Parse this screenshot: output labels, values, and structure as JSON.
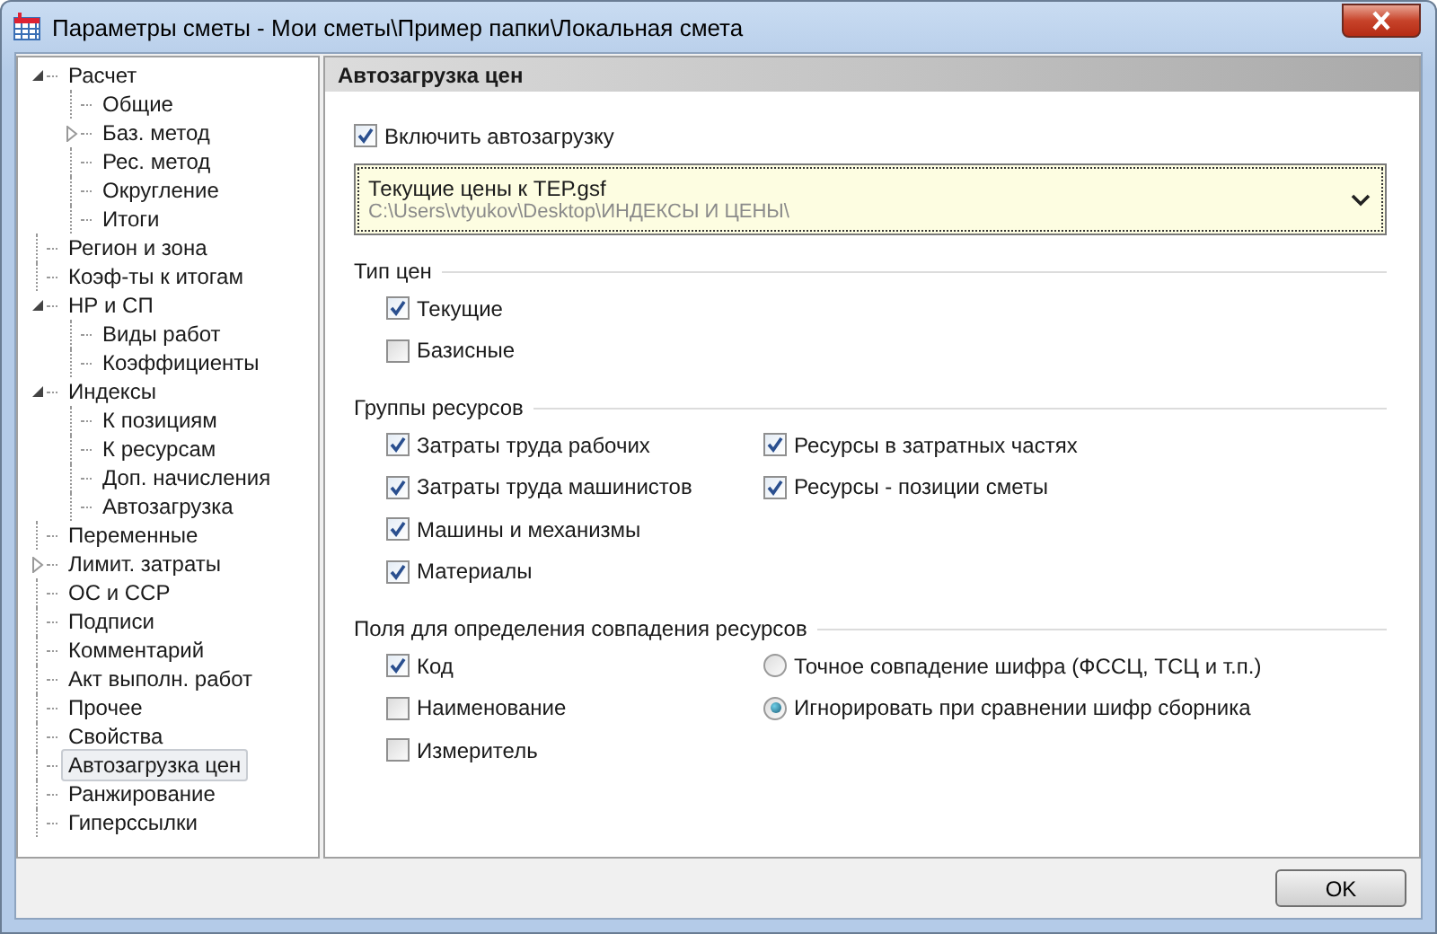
{
  "window": {
    "title": "Параметры сметы - Мои сметы\\Пример папки\\Локальная смета"
  },
  "sidebar": {
    "items": [
      {
        "label": "Расчет",
        "selected": false,
        "expanded": true,
        "children": [
          {
            "label": "Общие",
            "selected": false
          },
          {
            "label": "Баз. метод",
            "selected": false,
            "expanded": false
          },
          {
            "label": "Рес. метод",
            "selected": false
          },
          {
            "label": "Округление",
            "selected": false
          },
          {
            "label": "Итоги",
            "selected": false
          }
        ]
      },
      {
        "label": "Регион и зона",
        "selected": false
      },
      {
        "label": "Коэф-ты к итогам",
        "selected": false
      },
      {
        "label": "НР и СП",
        "selected": false,
        "expanded": true,
        "children": [
          {
            "label": "Виды работ",
            "selected": false
          },
          {
            "label": "Коэффициенты",
            "selected": false
          }
        ]
      },
      {
        "label": "Индексы",
        "selected": false,
        "expanded": true,
        "children": [
          {
            "label": "К позициям",
            "selected": false
          },
          {
            "label": "К ресурсам",
            "selected": false
          },
          {
            "label": "Доп. начисления",
            "selected": false
          },
          {
            "label": "Автозагрузка",
            "selected": false
          }
        ]
      },
      {
        "label": "Переменные",
        "selected": false
      },
      {
        "label": "Лимит. затраты",
        "selected": false,
        "expanded": false
      },
      {
        "label": "ОС и ССР",
        "selected": false
      },
      {
        "label": "Подписи",
        "selected": false
      },
      {
        "label": "Комментарий",
        "selected": false
      },
      {
        "label": "Акт выполн. работ",
        "selected": false
      },
      {
        "label": "Прочее",
        "selected": false
      },
      {
        "label": "Свойства",
        "selected": false
      },
      {
        "label": "Автозагрузка цен",
        "selected": true
      },
      {
        "label": "Ранжирование",
        "selected": false
      },
      {
        "label": "Гиперссылки",
        "selected": false
      }
    ]
  },
  "panel": {
    "title": "Автозагрузка цен",
    "autoload": {
      "label": "Включить автозагрузку",
      "checked": true
    },
    "price_file": {
      "name": "Текущие цены к ТЕР.gsf",
      "path": "C:\\Users\\vtyukov\\Desktop\\ИНДЕКСЫ И ЦЕНЫ\\"
    },
    "sections": [
      {
        "title": "Тип цен",
        "columns": [
          [
            {
              "kind": "checkbox",
              "label": "Текущие",
              "checked": true
            },
            {
              "kind": "checkbox",
              "label": "Базисные",
              "checked": false
            }
          ]
        ]
      },
      {
        "title": "Группы ресурсов",
        "columns": [
          [
            {
              "kind": "checkbox",
              "label": "Затраты труда рабочих",
              "checked": true
            },
            {
              "kind": "checkbox",
              "label": "Затраты труда машинистов",
              "checked": true
            },
            {
              "kind": "checkbox",
              "label": "Машины и механизмы",
              "checked": true
            },
            {
              "kind": "checkbox",
              "label": "Материалы",
              "checked": true
            }
          ],
          [
            {
              "kind": "checkbox",
              "label": "Ресурсы в затратных частях",
              "checked": true
            },
            {
              "kind": "checkbox",
              "label": "Ресурсы - позиции сметы",
              "checked": true
            }
          ]
        ]
      },
      {
        "title": "Поля для определения совпадения ресурсов",
        "columns": [
          [
            {
              "kind": "checkbox",
              "label": "Код",
              "checked": true
            },
            {
              "kind": "checkbox",
              "label": "Наименование",
              "checked": false
            },
            {
              "kind": "checkbox",
              "label": "Измеритель",
              "checked": false
            }
          ],
          [
            {
              "kind": "radio",
              "label": "Точное совпадение шифра (ФССЦ, ТСЦ и т.п.)",
              "selected": false
            },
            {
              "kind": "radio",
              "label": "Игнорировать при сравнении шифр сборника",
              "selected": true
            }
          ]
        ]
      }
    ]
  },
  "buttons": [
    {
      "label": "OK"
    }
  ]
}
